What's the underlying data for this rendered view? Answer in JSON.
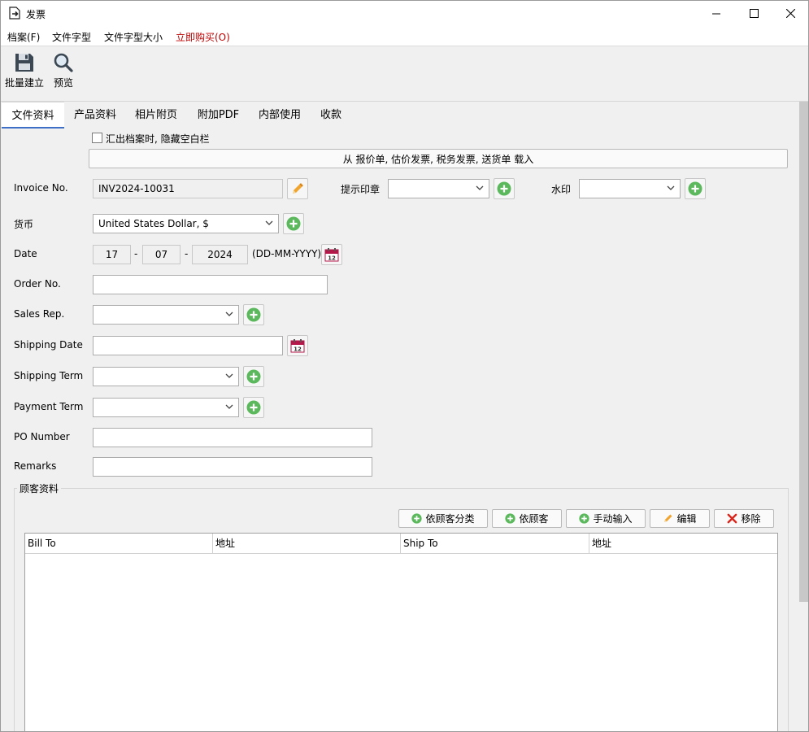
{
  "window": {
    "title": "发票"
  },
  "menu": {
    "file": "档案(F)",
    "font": "文件字型",
    "font_size": "文件字型大小",
    "buy": "立即购买(O)"
  },
  "toolbar": {
    "batch_create": "批量建立",
    "preview": "预览"
  },
  "tabs": [
    "文件资料",
    "产品资料",
    "相片附页",
    "附加PDF",
    "内部使用",
    "收款"
  ],
  "form": {
    "hide_blank_label": "汇出档案时, 隐藏空白栏",
    "load_button": "从 报价单, 估价发票, 税务发票, 送货单 载入",
    "invoice_no_label": "Invoice No.",
    "invoice_no_value": "INV2024-10031",
    "stamp_label": "提示印章",
    "watermark_label": "水印",
    "currency_label": "货币",
    "currency_value": "United States Dollar, $",
    "date_label": "Date",
    "date_day": "17",
    "date_month": "07",
    "date_year": "2024",
    "date_sep": "-",
    "date_format": "(DD-MM-YYYY)",
    "order_no_label": "Order No.",
    "sales_rep_label": "Sales Rep.",
    "shipping_date_label": "Shipping Date",
    "shipping_term_label": "Shipping Term",
    "payment_term_label": "Payment Term",
    "po_number_label": "PO Number",
    "remarks_label": "Remarks",
    "calendar_number": "12"
  },
  "customer": {
    "group_title": "顾客资料",
    "btn_by_category": "依顾客分类",
    "btn_by_customer": "依顾客",
    "btn_manual": "手动输入",
    "btn_edit": "编辑",
    "btn_remove": "移除",
    "columns": [
      "Bill To",
      "地址",
      "Ship To",
      "地址"
    ]
  },
  "colors": {
    "accent_tab": "#3d6fc6",
    "buy_red": "#c00000",
    "plus_green": "#5cb85c",
    "calendar_red": "#b5174a"
  }
}
